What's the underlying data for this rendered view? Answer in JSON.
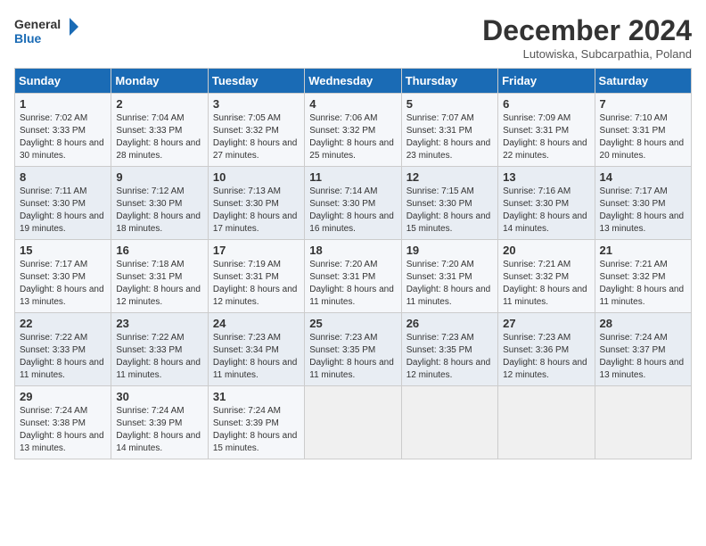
{
  "header": {
    "logo_line1": "General",
    "logo_line2": "Blue",
    "month": "December 2024",
    "location": "Lutowiska, Subcarpathia, Poland"
  },
  "days_of_week": [
    "Sunday",
    "Monday",
    "Tuesday",
    "Wednesday",
    "Thursday",
    "Friday",
    "Saturday"
  ],
  "weeks": [
    [
      {
        "day": "1",
        "sunrise": "Sunrise: 7:02 AM",
        "sunset": "Sunset: 3:33 PM",
        "daylight": "Daylight: 8 hours and 30 minutes."
      },
      {
        "day": "2",
        "sunrise": "Sunrise: 7:04 AM",
        "sunset": "Sunset: 3:33 PM",
        "daylight": "Daylight: 8 hours and 28 minutes."
      },
      {
        "day": "3",
        "sunrise": "Sunrise: 7:05 AM",
        "sunset": "Sunset: 3:32 PM",
        "daylight": "Daylight: 8 hours and 27 minutes."
      },
      {
        "day": "4",
        "sunrise": "Sunrise: 7:06 AM",
        "sunset": "Sunset: 3:32 PM",
        "daylight": "Daylight: 8 hours and 25 minutes."
      },
      {
        "day": "5",
        "sunrise": "Sunrise: 7:07 AM",
        "sunset": "Sunset: 3:31 PM",
        "daylight": "Daylight: 8 hours and 23 minutes."
      },
      {
        "day": "6",
        "sunrise": "Sunrise: 7:09 AM",
        "sunset": "Sunset: 3:31 PM",
        "daylight": "Daylight: 8 hours and 22 minutes."
      },
      {
        "day": "7",
        "sunrise": "Sunrise: 7:10 AM",
        "sunset": "Sunset: 3:31 PM",
        "daylight": "Daylight: 8 hours and 20 minutes."
      }
    ],
    [
      {
        "day": "8",
        "sunrise": "Sunrise: 7:11 AM",
        "sunset": "Sunset: 3:30 PM",
        "daylight": "Daylight: 8 hours and 19 minutes."
      },
      {
        "day": "9",
        "sunrise": "Sunrise: 7:12 AM",
        "sunset": "Sunset: 3:30 PM",
        "daylight": "Daylight: 8 hours and 18 minutes."
      },
      {
        "day": "10",
        "sunrise": "Sunrise: 7:13 AM",
        "sunset": "Sunset: 3:30 PM",
        "daylight": "Daylight: 8 hours and 17 minutes."
      },
      {
        "day": "11",
        "sunrise": "Sunrise: 7:14 AM",
        "sunset": "Sunset: 3:30 PM",
        "daylight": "Daylight: 8 hours and 16 minutes."
      },
      {
        "day": "12",
        "sunrise": "Sunrise: 7:15 AM",
        "sunset": "Sunset: 3:30 PM",
        "daylight": "Daylight: 8 hours and 15 minutes."
      },
      {
        "day": "13",
        "sunrise": "Sunrise: 7:16 AM",
        "sunset": "Sunset: 3:30 PM",
        "daylight": "Daylight: 8 hours and 14 minutes."
      },
      {
        "day": "14",
        "sunrise": "Sunrise: 7:17 AM",
        "sunset": "Sunset: 3:30 PM",
        "daylight": "Daylight: 8 hours and 13 minutes."
      }
    ],
    [
      {
        "day": "15",
        "sunrise": "Sunrise: 7:17 AM",
        "sunset": "Sunset: 3:30 PM",
        "daylight": "Daylight: 8 hours and 13 minutes."
      },
      {
        "day": "16",
        "sunrise": "Sunrise: 7:18 AM",
        "sunset": "Sunset: 3:31 PM",
        "daylight": "Daylight: 8 hours and 12 minutes."
      },
      {
        "day": "17",
        "sunrise": "Sunrise: 7:19 AM",
        "sunset": "Sunset: 3:31 PM",
        "daylight": "Daylight: 8 hours and 12 minutes."
      },
      {
        "day": "18",
        "sunrise": "Sunrise: 7:20 AM",
        "sunset": "Sunset: 3:31 PM",
        "daylight": "Daylight: 8 hours and 11 minutes."
      },
      {
        "day": "19",
        "sunrise": "Sunrise: 7:20 AM",
        "sunset": "Sunset: 3:31 PM",
        "daylight": "Daylight: 8 hours and 11 minutes."
      },
      {
        "day": "20",
        "sunrise": "Sunrise: 7:21 AM",
        "sunset": "Sunset: 3:32 PM",
        "daylight": "Daylight: 8 hours and 11 minutes."
      },
      {
        "day": "21",
        "sunrise": "Sunrise: 7:21 AM",
        "sunset": "Sunset: 3:32 PM",
        "daylight": "Daylight: 8 hours and 11 minutes."
      }
    ],
    [
      {
        "day": "22",
        "sunrise": "Sunrise: 7:22 AM",
        "sunset": "Sunset: 3:33 PM",
        "daylight": "Daylight: 8 hours and 11 minutes."
      },
      {
        "day": "23",
        "sunrise": "Sunrise: 7:22 AM",
        "sunset": "Sunset: 3:33 PM",
        "daylight": "Daylight: 8 hours and 11 minutes."
      },
      {
        "day": "24",
        "sunrise": "Sunrise: 7:23 AM",
        "sunset": "Sunset: 3:34 PM",
        "daylight": "Daylight: 8 hours and 11 minutes."
      },
      {
        "day": "25",
        "sunrise": "Sunrise: 7:23 AM",
        "sunset": "Sunset: 3:35 PM",
        "daylight": "Daylight: 8 hours and 11 minutes."
      },
      {
        "day": "26",
        "sunrise": "Sunrise: 7:23 AM",
        "sunset": "Sunset: 3:35 PM",
        "daylight": "Daylight: 8 hours and 12 minutes."
      },
      {
        "day": "27",
        "sunrise": "Sunrise: 7:23 AM",
        "sunset": "Sunset: 3:36 PM",
        "daylight": "Daylight: 8 hours and 12 minutes."
      },
      {
        "day": "28",
        "sunrise": "Sunrise: 7:24 AM",
        "sunset": "Sunset: 3:37 PM",
        "daylight": "Daylight: 8 hours and 13 minutes."
      }
    ],
    [
      {
        "day": "29",
        "sunrise": "Sunrise: 7:24 AM",
        "sunset": "Sunset: 3:38 PM",
        "daylight": "Daylight: 8 hours and 13 minutes."
      },
      {
        "day": "30",
        "sunrise": "Sunrise: 7:24 AM",
        "sunset": "Sunset: 3:39 PM",
        "daylight": "Daylight: 8 hours and 14 minutes."
      },
      {
        "day": "31",
        "sunrise": "Sunrise: 7:24 AM",
        "sunset": "Sunset: 3:39 PM",
        "daylight": "Daylight: 8 hours and 15 minutes."
      },
      null,
      null,
      null,
      null
    ]
  ]
}
